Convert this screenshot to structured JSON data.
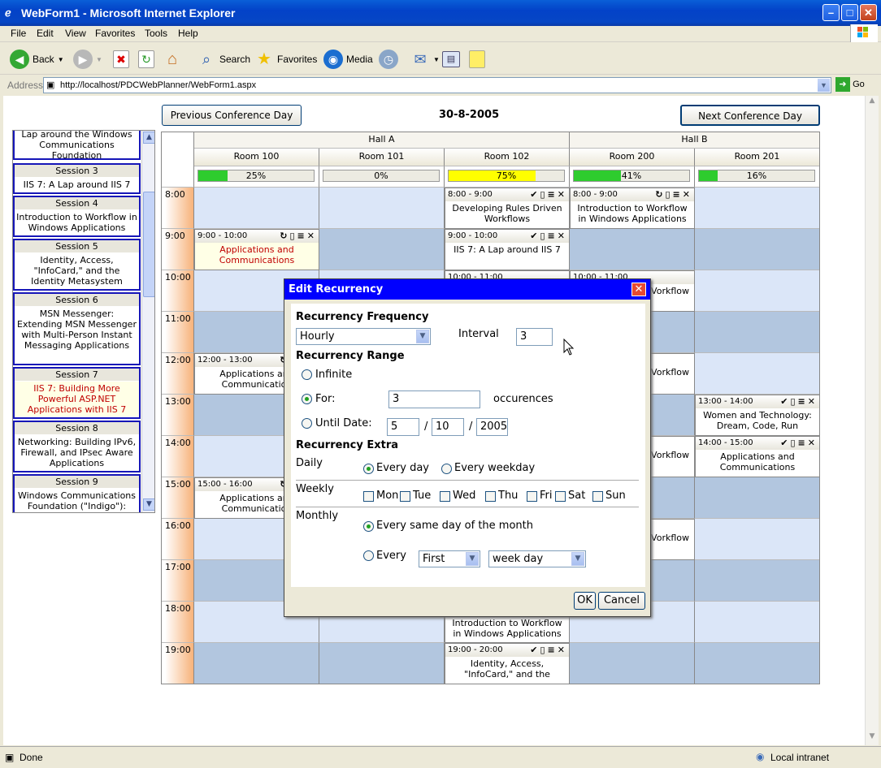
{
  "window": {
    "title": "WebForm1 - Microsoft Internet Explorer"
  },
  "menu": [
    "File",
    "Edit",
    "View",
    "Favorites",
    "Tools",
    "Help"
  ],
  "toolbar": {
    "back": "Back",
    "search": "Search",
    "favorites": "Favorites",
    "media": "Media"
  },
  "address": {
    "label": "Address",
    "url": "http://localhost/PDCWebPlanner/WebForm1.aspx",
    "go": "Go"
  },
  "status": {
    "left": "Done",
    "right": "Local intranet"
  },
  "planner": {
    "prev": "Previous Conference Day",
    "next": "Next Conference Day",
    "date": "30-8-2005",
    "halls": [
      "Hall A",
      "Hall B"
    ],
    "rooms": [
      {
        "name": "Room 100",
        "load": "25%",
        "fill": 0.25,
        "color": "#2ecc2e"
      },
      {
        "name": "Room 101",
        "load": "0%",
        "fill": 0,
        "color": "#2ecc2e"
      },
      {
        "name": "Room 102",
        "load": "75%",
        "fill": 0.75,
        "color": "#ffff00"
      },
      {
        "name": "Room 200",
        "load": "41%",
        "fill": 0.41,
        "color": "#2ecc2e"
      },
      {
        "name": "Room 201",
        "load": "16%",
        "fill": 0.16,
        "color": "#2ecc2e"
      }
    ],
    "times": [
      "8:00",
      "9:00",
      "10:00",
      "11:00",
      "12:00",
      "13:00",
      "14:00",
      "15:00",
      "16:00",
      "17:00",
      "18:00",
      "19:00"
    ]
  },
  "sessions": [
    {
      "head": "",
      "body": "Lap around the Windows Communications Foundation"
    },
    {
      "head": "Session 3",
      "body": "IIS 7: A Lap around IIS 7"
    },
    {
      "head": "Session 4",
      "body": "Introduction to Workflow in Windows Applications"
    },
    {
      "head": "Session 5",
      "body": "Identity, Access, \"InfoCard,\" and the Identity Metasystem"
    },
    {
      "head": "Session 6",
      "body": "MSN Messenger: Extending MSN Messenger with Multi-Person Instant Messaging Applications"
    },
    {
      "head": "Session 7",
      "body": "IIS 7: Building More Powerful ASP.NET Applications with IIS 7"
    },
    {
      "head": "Session 8",
      "body": "Networking: Building IPv6, Firewall, and IPsec Aware Applications"
    },
    {
      "head": "Session 9",
      "body": "Windows Communications Foundation (\"Indigo\"):"
    }
  ],
  "appointments": [
    {
      "time": "8:00 - 9:00",
      "icons": "✔▯≡✕",
      "title": "Developing Rules Driven Workflows"
    },
    {
      "time": "8:00 - 9:00",
      "icons": "↻▯≡✕",
      "title": "Introduction to Workflow in Windows Applications"
    },
    {
      "time": "9:00 - 10:00",
      "icons": "↻▯≡✕",
      "title": "Applications and Communications"
    },
    {
      "time": "9:00 - 10:00",
      "icons": "✔▯≡✕",
      "title": "IIS 7: A Lap around IIS 7"
    },
    {
      "time": "12:00 - 13:00",
      "icons": "↻▯≡✕",
      "title": "Applications and Communication"
    },
    {
      "time": "13:00 - 14:00",
      "icons": "✔▯≡✕",
      "title": "Women and Technology: Dream, Code, Run"
    },
    {
      "time": "14:00 - 15:00",
      "icons": "✔▯≡✕",
      "title": "Applications and Communications"
    },
    {
      "time": "15:00 - 16:00",
      "icons": "↻▯≡✕",
      "title": "Applications and Communication"
    },
    {
      "time": "",
      "icons": "",
      "title": "Introduction to Workflow in Windows Applications"
    },
    {
      "time": "19:00 - 20:00",
      "icons": "✔▯≡✕",
      "title": "Identity, Access, \"InfoCard,\" and the"
    },
    {
      "time": "10:00 - 11:00",
      "icons": "",
      "title": ""
    },
    {
      "time": "10:00 - 11:00",
      "icons": "",
      "title": ""
    }
  ],
  "partial": {
    "workflow": "Vorkflow",
    "applications": "Applications"
  },
  "dialog": {
    "title": "Edit Recurrency",
    "freq_label": "Recurrency Frequency",
    "freq_value": "Hourly",
    "interval_label": "Interval",
    "interval_value": "3",
    "range_label": "Recurrency Range",
    "infinite": "Infinite",
    "for": "For:",
    "for_value": "3",
    "occurences": "occurences",
    "until": "Until Date:",
    "day": "5",
    "month": "10",
    "year": "2005",
    "sep": "/",
    "extra_label": "Recurrency Extra",
    "daily": "Daily",
    "every_day": "Every day",
    "every_weekday": "Every weekday",
    "weekly": "Weekly",
    "days": [
      "Mon",
      "Tue",
      "Wed",
      "Thu",
      "Fri",
      "Sat",
      "Sun"
    ],
    "monthly": "Monthly",
    "same_day": "Every same day of the month",
    "every": "Every",
    "ordinal": "First",
    "dayType": "week day",
    "ok": "OK",
    "cancel": "Cancel"
  }
}
